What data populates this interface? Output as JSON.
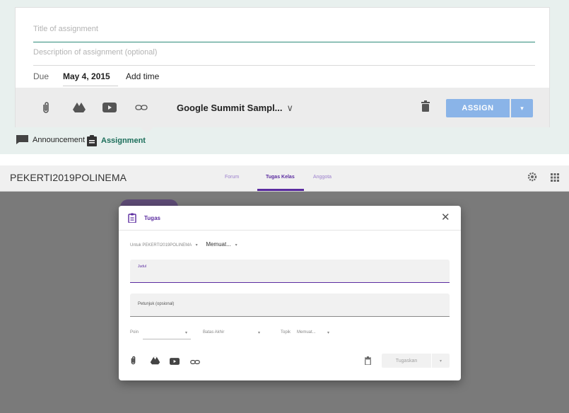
{
  "old_ui": {
    "title_placeholder": "Title of assignment",
    "description_placeholder": "Description of assignment (optional)",
    "due_label": "Due",
    "due_date": "May 4, 2015",
    "add_time": "Add time",
    "course_selector": "Google Summit Sampl...",
    "course_chevron": "∨",
    "assign_button": "ASSIGN",
    "assign_dropdown": "▾",
    "post_types": {
      "announcement": "Announcement",
      "assignment": "Assignment"
    },
    "accent_color": "#1b6e5a",
    "button_color": "#8ab4e8"
  },
  "new_ui": {
    "class_name": "PEKERTI2019POLINEMA",
    "tabs": [
      {
        "label": "Forum",
        "active": false
      },
      {
        "label": "Tugas Kelas",
        "active": true
      },
      {
        "label": "Anggota",
        "active": false
      }
    ],
    "dialog": {
      "title": "Tugas",
      "close": "✕",
      "for_label": "Untuk",
      "for_course": "PEKERTI2019POLINEMA",
      "for_students": "Memuat...",
      "chevron": "▾",
      "judul_label": "Judul",
      "petunjuk_label": "Petunjuk (opsional)",
      "poin_label": "Poin",
      "batas_label": "Batas Akhir",
      "topik_label": "Topik",
      "topik_value": "Memuat...",
      "submit_button": "Tugaskan",
      "submit_dropdown": "▾"
    },
    "accent_color": "#5b2ca0"
  }
}
